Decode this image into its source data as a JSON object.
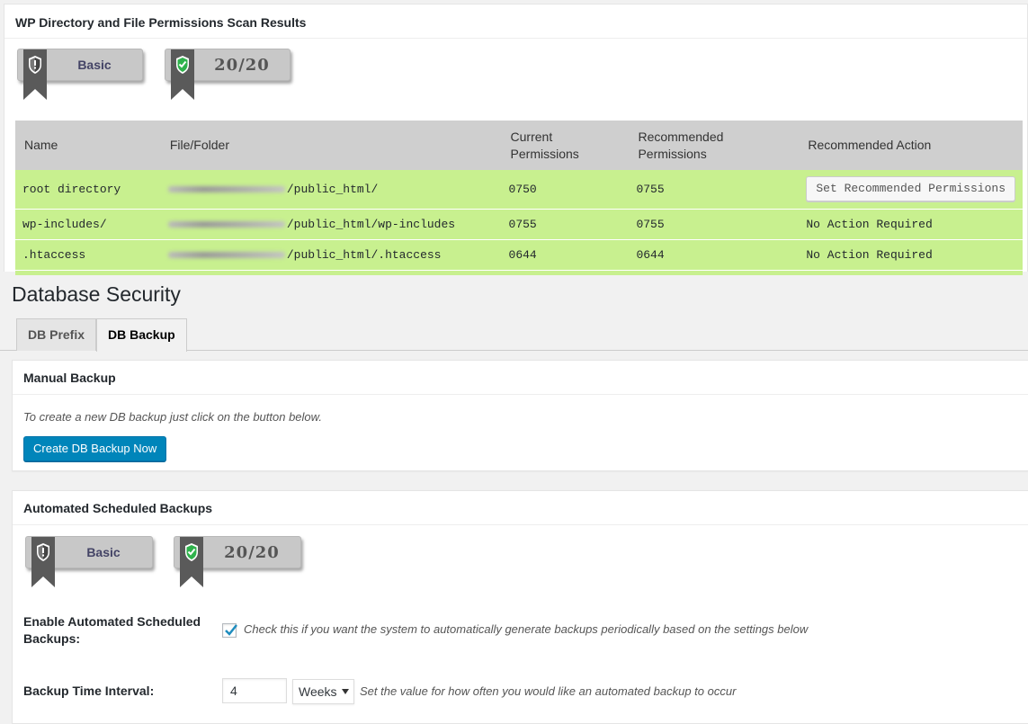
{
  "scan_panel": {
    "title": "WP Directory and File Permissions Scan Results",
    "badge_level": "Basic",
    "badge_score": "20/20",
    "table": {
      "headers": [
        "Name",
        "File/Folder",
        "Current Permissions",
        "Recommended Permissions",
        "Recommended Action"
      ],
      "rows": [
        {
          "name": "root directory",
          "path": "/public_html/",
          "current": "0750",
          "recommended": "0755",
          "action": "Set Recommended Permissions",
          "action_is_button": true
        },
        {
          "name": "wp-includes/",
          "path": "/public_html/wp-includes",
          "current": "0755",
          "recommended": "0755",
          "action": "No Action Required",
          "action_is_button": false
        },
        {
          "name": ".htaccess",
          "path": "/public_html/.htaccess",
          "current": "0644",
          "recommended": "0644",
          "action": "No Action Required",
          "action_is_button": false
        }
      ]
    }
  },
  "db_security": {
    "title": "Database Security",
    "tabs": [
      {
        "label": "DB Prefix",
        "active": false
      },
      {
        "label": "DB Backup",
        "active": true
      }
    ]
  },
  "manual_backup": {
    "title": "Manual Backup",
    "hint": "To create a new DB backup just click on the button below.",
    "button": "Create DB Backup Now"
  },
  "scheduled_backups": {
    "title": "Automated Scheduled Backups",
    "badge_level": "Basic",
    "badge_score": "20/20",
    "enable_label": "Enable Automated Scheduled Backups:",
    "enable_checked": true,
    "enable_hint": "Check this if you want the system to automatically generate backups periodically based on the settings below",
    "interval_label": "Backup Time Interval:",
    "interval_value": "4",
    "interval_unit": "Weeks",
    "interval_hint": "Set the value for how often you would like an automated backup to occur"
  },
  "colors": {
    "row_green": "#c8f08f",
    "header_grey": "#cfcfcf",
    "primary_blue": "#0085ba",
    "ribbon_grey": "#5a5a5a",
    "shield_green": "#2fb24c"
  }
}
